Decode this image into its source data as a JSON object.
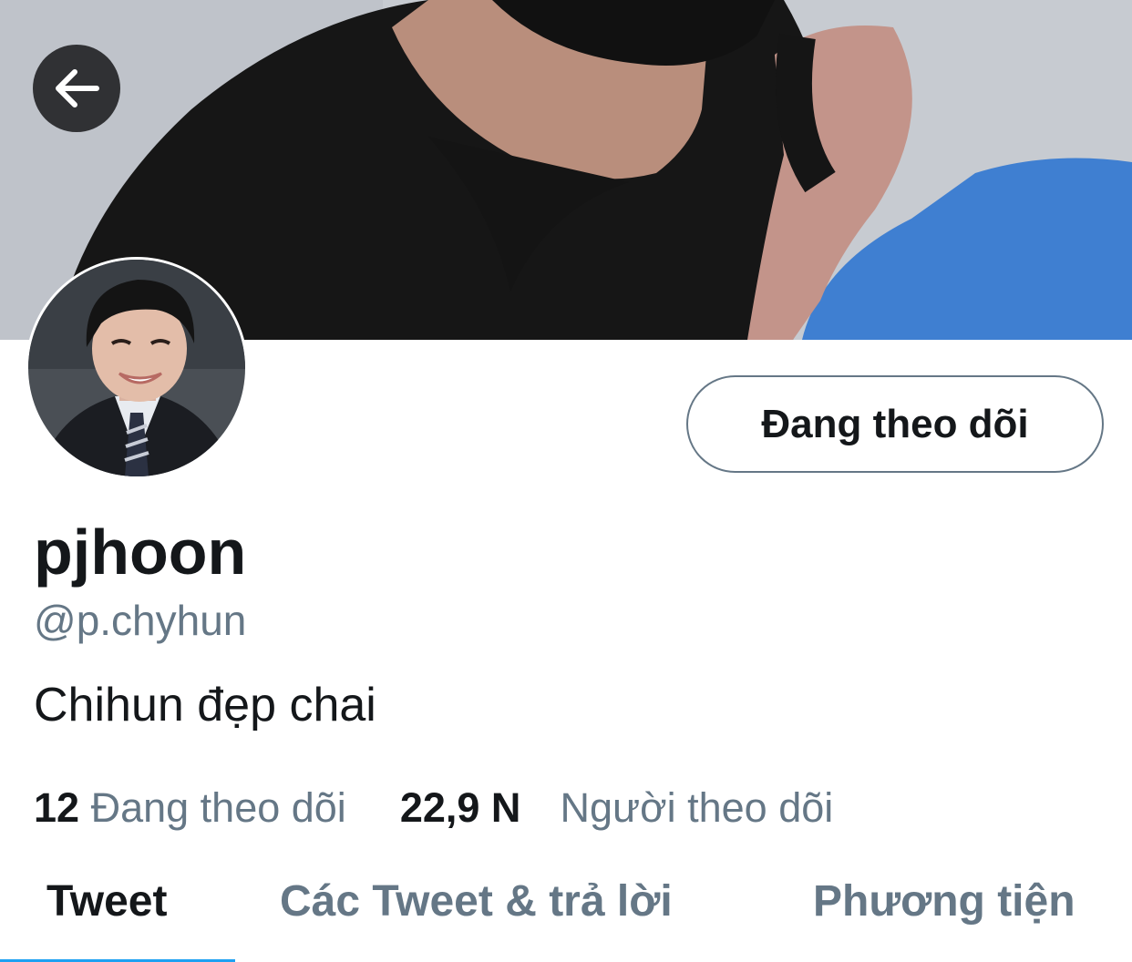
{
  "profile": {
    "display_name": "pjhoon",
    "handle": "@p.chyhun",
    "bio": "Chihun đẹp chai",
    "follow_button_label": "Đang theo dõi",
    "following_count": "12",
    "following_label": "Đang theo dõi",
    "followers_count": "22,9 N",
    "followers_label": "Người theo dõi"
  },
  "tabs": [
    {
      "label": "Tweet",
      "active": true
    },
    {
      "label": "Các Tweet & trả lời",
      "active": false
    },
    {
      "label": "Phương tiện",
      "active": false
    }
  ],
  "icons": {
    "back": "arrow-left-icon"
  },
  "colors": {
    "accent": "#1da1f2",
    "text_primary": "#14171a",
    "text_secondary": "#657786"
  }
}
